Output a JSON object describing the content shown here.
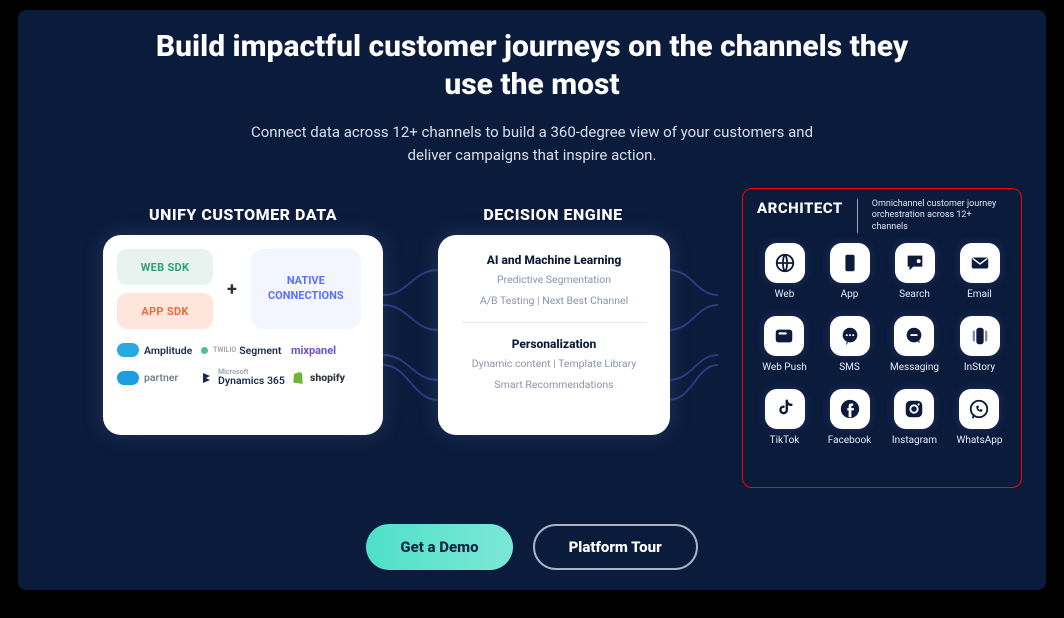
{
  "headline": "Build impactful customer journeys on the channels they use the most",
  "subhead": "Connect data across 12+ channels to build a 360-degree view of your customers and deliver campaigns that inspire action.",
  "columns": {
    "unify_title": "UNIFY CUSTOMER DATA",
    "decision_title": "DECISION ENGINE"
  },
  "unify": {
    "web_sdk": "WEB SDK",
    "app_sdk": "APP SDK",
    "plus": "+",
    "native_connections": "NATIVE CONNECTIONS",
    "logos": {
      "amplitude": "Amplitude",
      "segment": "Segment",
      "segment_prefix": "TWILIO",
      "mixpanel": "mixpanel",
      "salesforce_suffix": "partner",
      "dynamics_prefix": "Microsoft",
      "dynamics": "Dynamics 365",
      "shopify": "shopify"
    }
  },
  "decision": {
    "h1": "AI and Machine Learning",
    "p1a": "Predictive Segmentation",
    "p1b": "A/B Testing | Next Best Channel",
    "h2": "Personalization",
    "p2a": "Dynamic content | Template Library",
    "p2b": "Smart Recommendations"
  },
  "architect": {
    "title": "ARCHITECT",
    "desc": "Omnichannel customer journey orchestration across 12+ channels",
    "channels": [
      {
        "name": "Web"
      },
      {
        "name": "App"
      },
      {
        "name": "Search"
      },
      {
        "name": "Email"
      },
      {
        "name": "Web Push"
      },
      {
        "name": "SMS"
      },
      {
        "name": "Messaging"
      },
      {
        "name": "InStory"
      },
      {
        "name": "TikTok"
      },
      {
        "name": "Facebook"
      },
      {
        "name": "Instagram"
      },
      {
        "name": "WhatsApp"
      }
    ]
  },
  "cta": {
    "primary": "Get a Demo",
    "secondary": "Platform Tour"
  }
}
